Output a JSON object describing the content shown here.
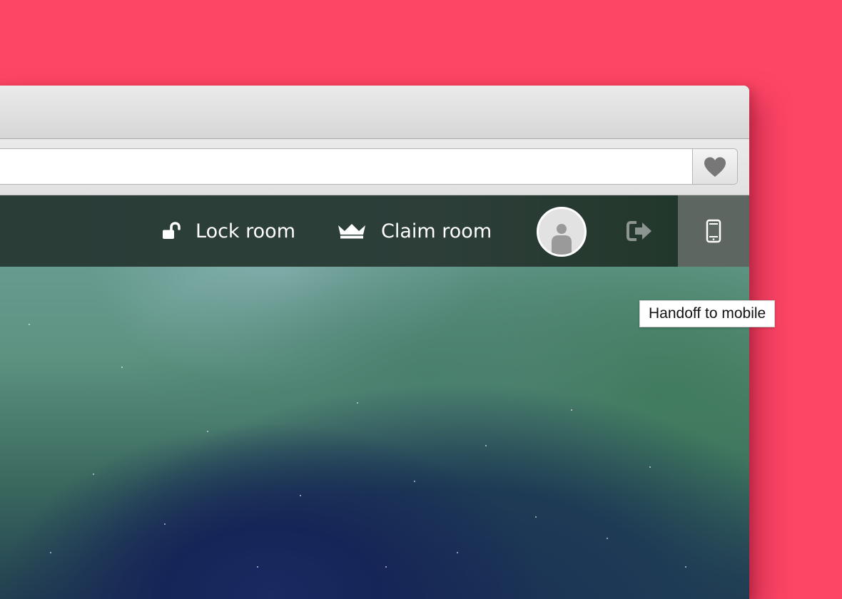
{
  "colors": {
    "background": "#fd4566",
    "nav_bar": "#2d3e39",
    "active_button": "#5d6661",
    "heart_icon": "#777777",
    "signout_icon": "#8c9591"
  },
  "toolbar": {
    "favorite_icon": "heart-icon"
  },
  "nav": {
    "lock_room": {
      "label": "Lock room",
      "icon": "unlocked-padlock-icon"
    },
    "claim_room": {
      "label": "Claim room",
      "icon": "crown-icon"
    },
    "avatar_icon": "user-avatar-icon",
    "signout_icon": "sign-out-icon",
    "mobile_icon": "mobile-phone-icon"
  },
  "tooltip": {
    "text": "Handoff to mobile"
  }
}
